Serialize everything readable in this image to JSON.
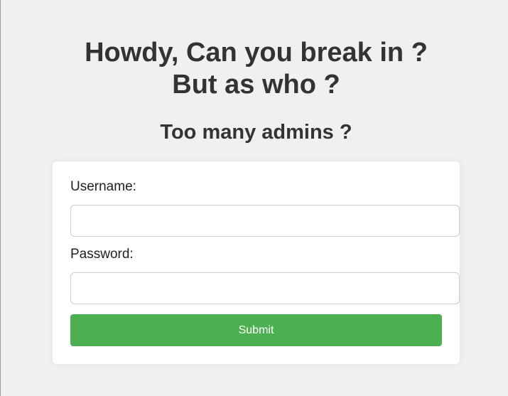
{
  "header": {
    "title_line1": "Howdy, Can you break in ?",
    "title_line2": "But as who ?",
    "subtitle": "Too many admins ?"
  },
  "form": {
    "username_label": "Username:",
    "username_value": "",
    "password_label": "Password:",
    "password_value": "",
    "submit_label": "Submit"
  },
  "colors": {
    "background": "#f0f0f0",
    "card": "#ffffff",
    "submit_button": "#4caf50",
    "heading_text": "#333333"
  }
}
